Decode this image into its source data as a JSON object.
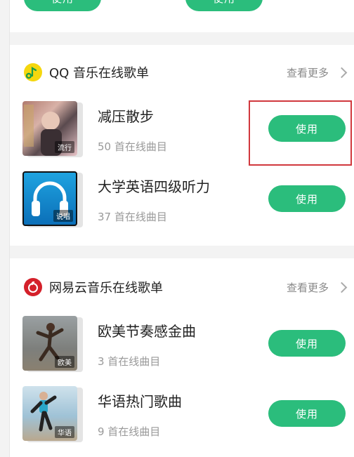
{
  "top_card": {
    "btn_left": "使用",
    "btn_right": "使用"
  },
  "sections": [
    {
      "title": "QQ 音乐在线歌单",
      "more": "查看更多",
      "playlists": [
        {
          "title": "减压散步",
          "count": "50 首在线曲目",
          "tag": "流行",
          "button": "使用"
        },
        {
          "title": "大学英语四级听力",
          "count": "37 首在线曲目",
          "tag": "说唱",
          "button": "使用"
        }
      ]
    },
    {
      "title": "网易云音乐在线歌单",
      "more": "查看更多",
      "playlists": [
        {
          "title": "欧美节奏感金曲",
          "count": "3 首在线曲目",
          "tag": "欧美",
          "button": "使用"
        },
        {
          "title": "华语热门歌曲",
          "count": "9 首在线曲目",
          "tag": "华语",
          "button": "使用"
        }
      ]
    }
  ],
  "colors": {
    "accent": "#2bbd7c",
    "qq_logo": "#f5d70e",
    "netease_logo": "#d4202a",
    "highlight": "#d1383d"
  }
}
